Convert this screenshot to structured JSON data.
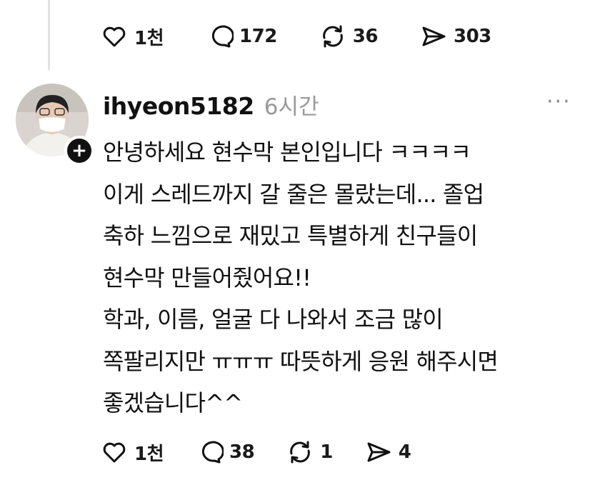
{
  "previous_post": {
    "actions": {
      "likes": "1천",
      "replies": "172",
      "reposts": "36",
      "shares": "303"
    }
  },
  "reply": {
    "username": "ihyeon5182",
    "timestamp": "6시간",
    "more_label": "···",
    "follow_label": "+",
    "lines": [
      "안녕하세요 현수막 본인입니다 ㅋㅋㅋㅋ",
      "이게 스레드까지 갈 줄은 몰랐는데... 졸업",
      "축하 느낌으로 재밌고 특별하게 친구들이",
      "현수막 만들어줬어요!!",
      "학과, 이름, 얼굴 다 나와서 조금 많이",
      "쪽팔리지만 ㅠㅠㅠ 따뜻하게 응원 해주시면",
      "좋겠습니다^^"
    ],
    "actions": {
      "likes": "1천",
      "replies": "38",
      "reposts": "1",
      "shares": "4"
    }
  },
  "colors": {
    "text": "#111111",
    "muted": "#9a9a9a",
    "thread_line": "#e2e2e2"
  }
}
